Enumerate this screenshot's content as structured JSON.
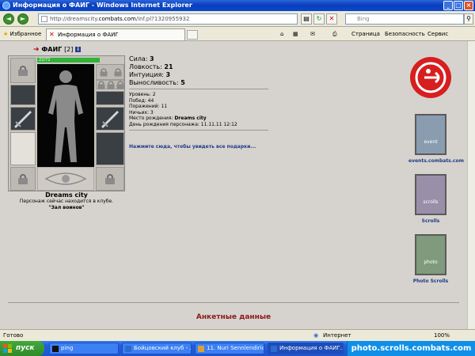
{
  "window": {
    "title": "Информация о ФАИГ - Windows Internet Explorer"
  },
  "address": {
    "url_prefix": "http://dreamscity.",
    "url_domain": "combats.com",
    "url_path": "/inf.pl?1320955932",
    "search_placeholder": "Bing"
  },
  "toolbar": {
    "favorites_label": "Избранное",
    "tab_label": "Информация о ФАИГ",
    "page_menu": "Страница",
    "safety_menu": "Безопасность",
    "service_menu": "Сервис"
  },
  "character": {
    "name": "ФАИГ",
    "level": "[2]",
    "hp": "22/72",
    "city": "Dreams city",
    "location_note": "Персонаж сейчас находится в клубе.",
    "room": "\"Зал воинов\""
  },
  "stats": [
    {
      "label": "Сила:",
      "value": "3"
    },
    {
      "label": "Ловкость:",
      "value": "21"
    },
    {
      "label": "Интуиция:",
      "value": "3"
    },
    {
      "label": "Выносливость:",
      "value": "5"
    }
  ],
  "details": {
    "level": "Уровень: 2",
    "wins": "Побед: 44",
    "losses": "Поражений: 11",
    "draws": "Ничьих: 3",
    "birthplace_label": "Место рождения: ",
    "birthplace_value": "Dreams city",
    "birthday": "День рождения персонажа: 11.11.11 12:12"
  },
  "gifts_link": "Нажмите сюда, чтобы увидеть все подарки...",
  "side_links": [
    {
      "label": "events.combats.com",
      "banner_text": "event"
    },
    {
      "label": "Scrolls",
      "banner_text": "scrolls"
    },
    {
      "label": "Photo Scrolls",
      "banner_text": "photo"
    }
  ],
  "anketa": "Анкетные данные",
  "status": {
    "left": "Готово",
    "zone": "Интернет",
    "zoom": "100%"
  },
  "taskbar": {
    "start": "пуск",
    "tasks": [
      "ping",
      "Бойцовский клуб - ...",
      "11. Nuri Sennlendirici ...",
      "Информация о ФАИГ..."
    ],
    "watermark": "photo.scrolls.combats.com"
  },
  "colors": {
    "accent_red": "#d61f1f",
    "link_blue": "#1e3a8a",
    "title_blue": "#0a3fbf"
  }
}
